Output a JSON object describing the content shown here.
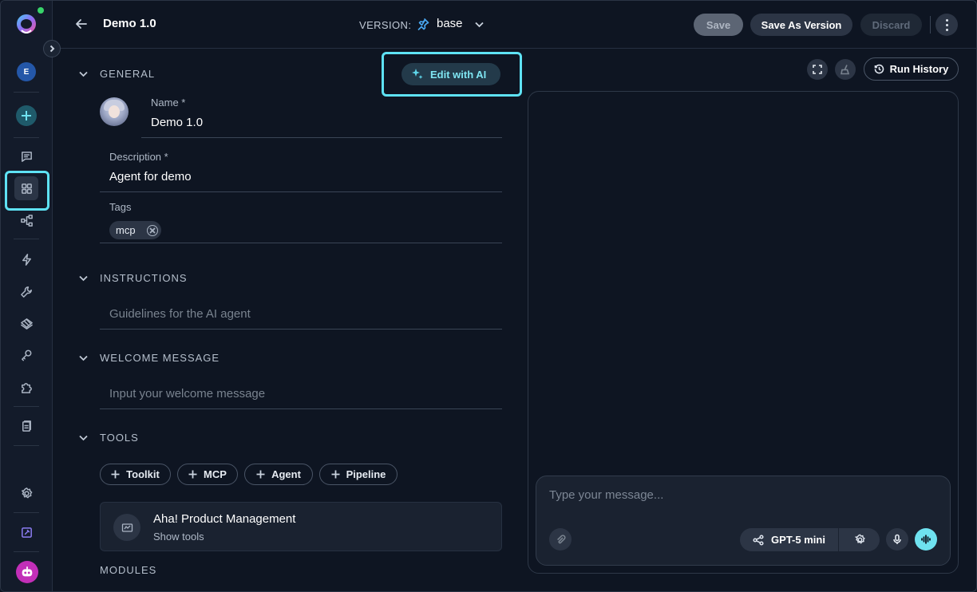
{
  "header": {
    "title": "Demo 1.0",
    "version_label": "VERSION:",
    "version_value": "base",
    "save_label": "Save",
    "save_as_version_label": "Save As Version",
    "discard_label": "Discard"
  },
  "sidebar": {
    "user_initial": "E"
  },
  "general": {
    "section_title": "GENERAL",
    "edit_with_ai_label": "Edit with AI",
    "name_label": "Name *",
    "name_value": "Demo 1.0",
    "description_label": "Description *",
    "description_value": "Agent for demo",
    "tags_label": "Tags",
    "tags": [
      "mcp"
    ]
  },
  "instructions": {
    "section_title": "INSTRUCTIONS",
    "placeholder": "Guidelines for the AI agent"
  },
  "welcome": {
    "section_title": "WELCOME MESSAGE",
    "placeholder": "Input your welcome message"
  },
  "tools": {
    "section_title": "TOOLS",
    "add_buttons": [
      "Toolkit",
      "MCP",
      "Agent",
      "Pipeline"
    ],
    "items": [
      {
        "title": "Aha! Product Management",
        "subtitle": "Show tools"
      }
    ]
  },
  "modules": {
    "section_title": "MODULES"
  },
  "chat": {
    "run_history_label": "Run History",
    "input_placeholder": "Type your message...",
    "model_label": "GPT-5 mini"
  },
  "colors": {
    "background": "#0e1522",
    "accent": "#5ee2f4",
    "highlight_border": "#5ee2f4"
  }
}
